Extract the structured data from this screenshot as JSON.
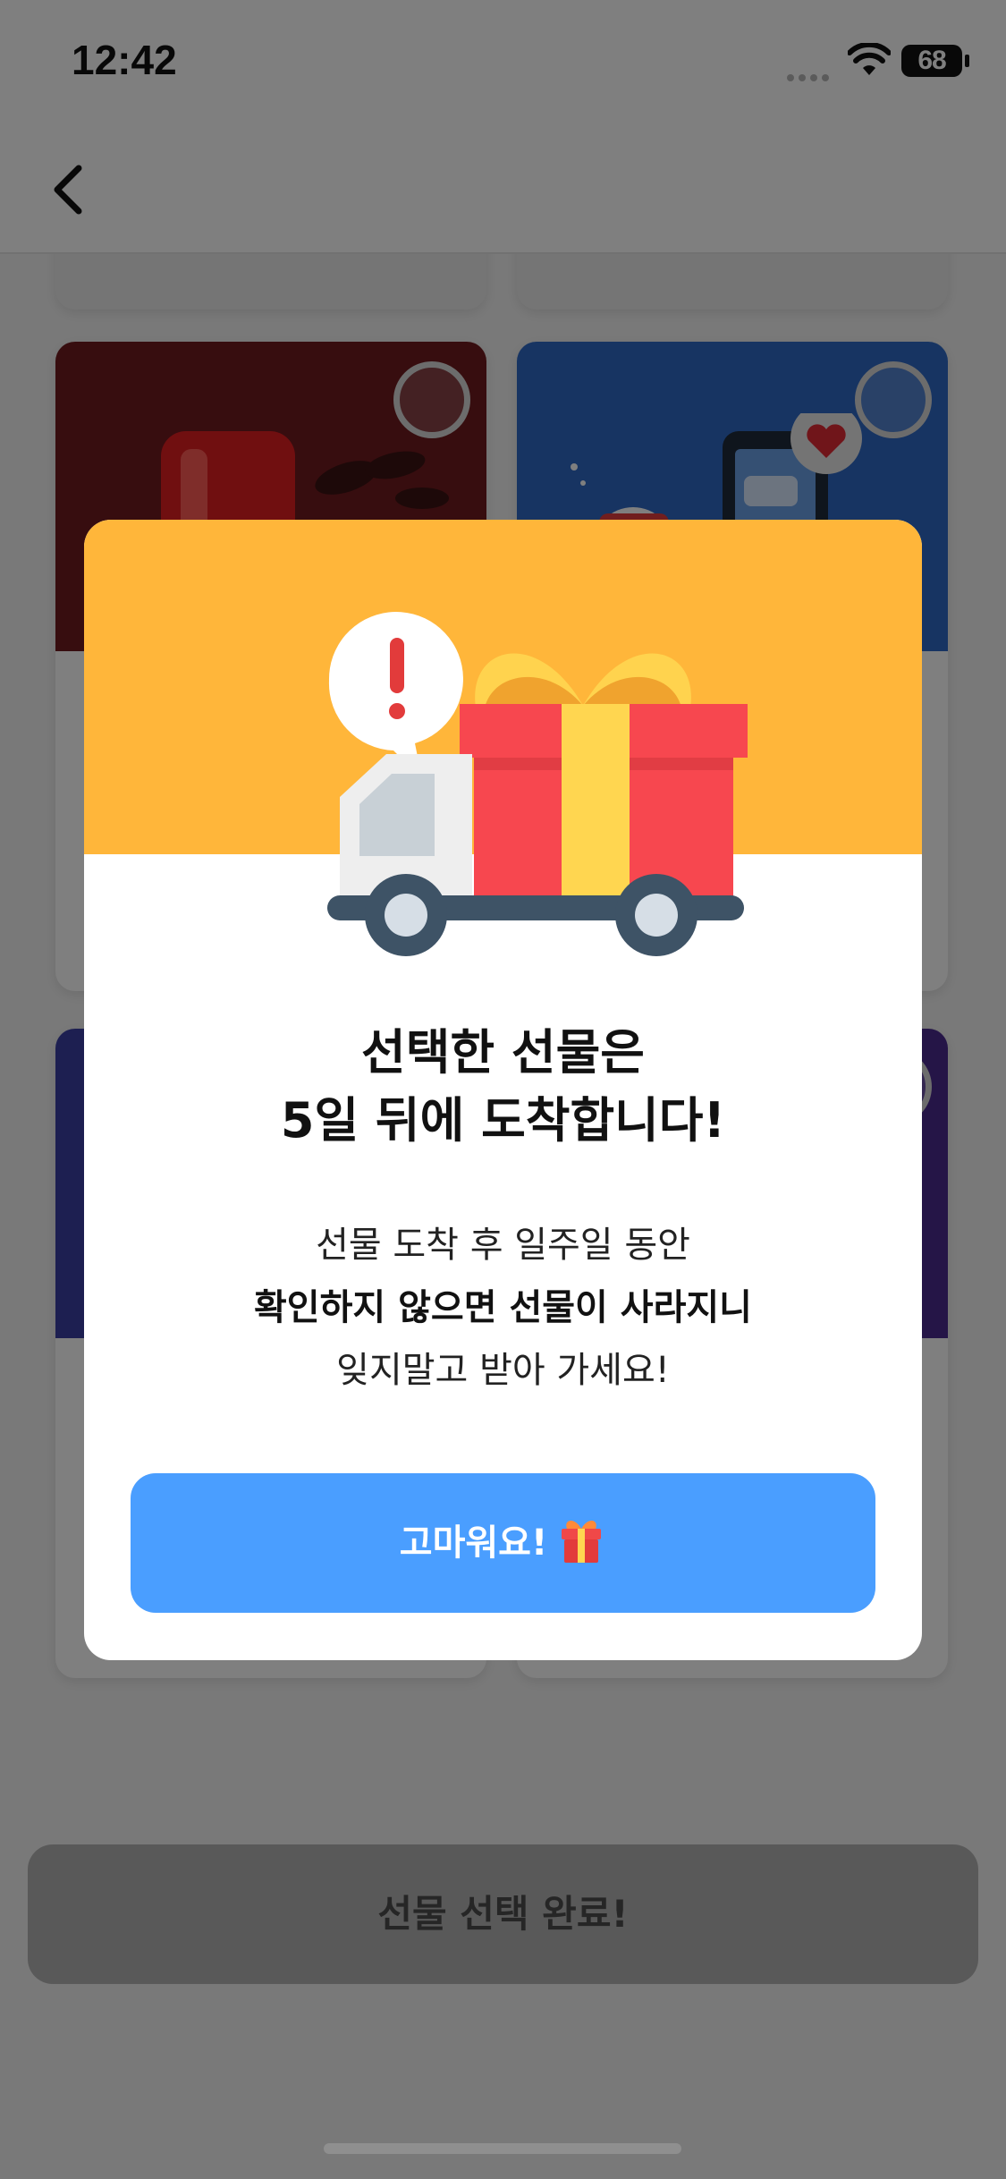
{
  "status_bar": {
    "time": "12:42",
    "battery": "68"
  },
  "nav": {
    "back_icon": "chevron-left-icon"
  },
  "colors": {
    "modal_header": "#ffb63a",
    "primary_button": "#4a9eff",
    "gift_red": "#f7474f",
    "gift_ribbon": "#ffd650",
    "truck_dark": "#3e5366"
  },
  "modal": {
    "title_line1": "선택한 선물은",
    "title_line2": "5일 뒤에 도착합니다!",
    "body_line1": "선물 도착 후 일주일 동안",
    "body_line2": "확인하지 않으면 선물이 사라지니",
    "body_line3": "잊지말고 받아 가세요!",
    "button_label": "고마워요!",
    "button_icon": "gift-icon",
    "illustration": "gift-truck-icon"
  },
  "footer": {
    "complete_label": "선물 선택 완료!"
  }
}
